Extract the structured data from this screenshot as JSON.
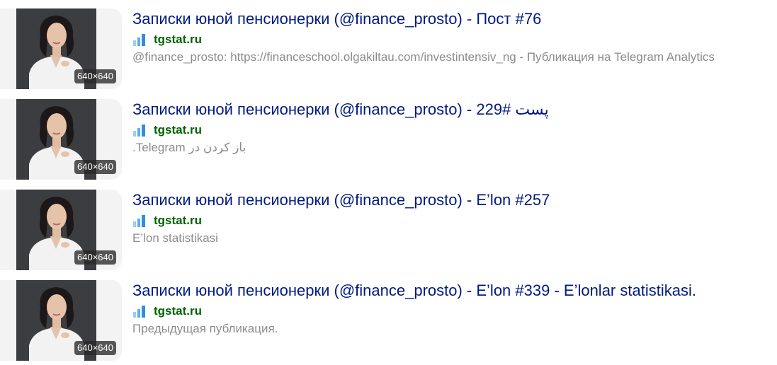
{
  "results": [
    {
      "title": "Записки юной пенсионерки (@finance_prosto) - Пост #76",
      "domain": "tgstat.ru",
      "snippet": "@finance_prosto: https://financeschool.olgakiltau.com/investintensiv_ng - Публикация на Telegram Analytics",
      "image_size": "640×640",
      "favicon": "tgstat-bars-icon",
      "snippet_dir": "ltr"
    },
    {
      "title": "Записки юной пенсионерки (@finance_prosto) - 229# پست",
      "domain": "tgstat.ru",
      "snippet": "باز کردن در Telegram.",
      "image_size": "640×640",
      "favicon": "tgstat-bars-icon",
      "snippet_dir": "rtl"
    },
    {
      "title": "Записки юной пенсионерки (@finance_prosto) - E’lon #257",
      "domain": "tgstat.ru",
      "snippet": "E’lon statistikasi",
      "image_size": "640×640",
      "favicon": "tgstat-bars-icon",
      "snippet_dir": "ltr"
    },
    {
      "title": "Записки юной пенсионерки (@finance_prosto) - E’lon #339 - E’lonlar statistikasi.",
      "domain": "tgstat.ru",
      "snippet": "Предыдущая публикация.",
      "image_size": "640×640",
      "favicon": "tgstat-bars-icon",
      "snippet_dir": "ltr"
    }
  ],
  "colors": {
    "title": "#001a80",
    "domain": "#006400",
    "snippet": "#8c8c8c",
    "favicon": "#3d9ae8"
  }
}
